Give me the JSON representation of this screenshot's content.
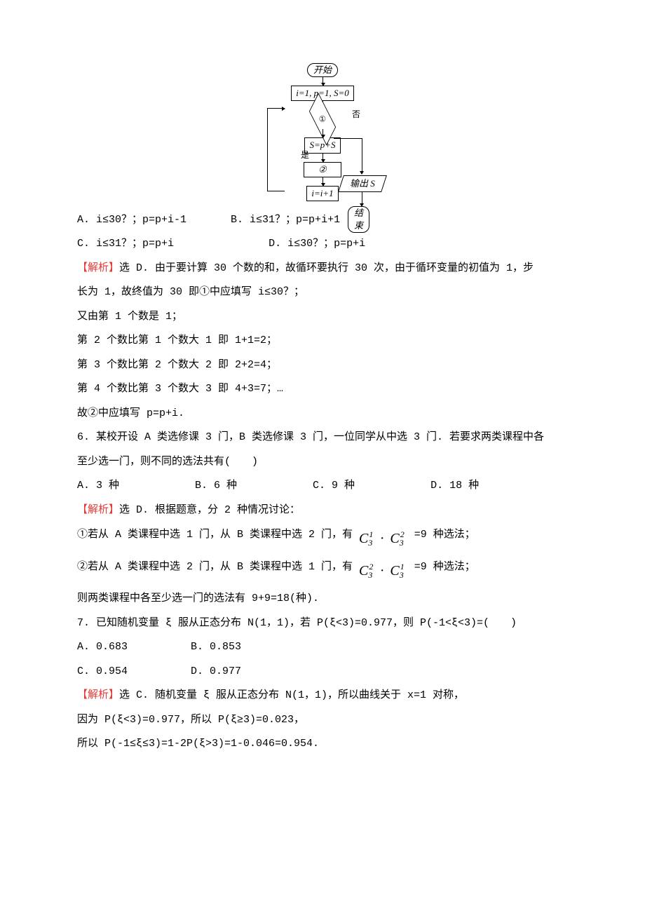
{
  "flow": {
    "start": "开始",
    "init": "i=1, p=1, S=0",
    "cond": "①",
    "yes": "是",
    "no": "否",
    "step1": "S=p+S",
    "out": "输出 S",
    "step2": "②",
    "end": "结束",
    "incr": "i=i+1"
  },
  "optA": "A. i≤30？；p=p+i-1",
  "optB": "B. i≤31？；p=p+i+1",
  "optC": "C. i≤31？；p=p+i",
  "optD": "D. i≤30？；p=p+i",
  "sol5_tag": "【解析】",
  "sol5_1a": "选 D. 由于要计算 30 个数的和，故循环要执行 30 次，由于循环变量的初值为 1，步",
  "sol5_1b": "长为 1，故终值为 30 即①中应填写 i≤30？；",
  "sol5_2": "又由第 1 个数是 1；",
  "sol5_3": "第 2 个数比第 1 个数大 1 即 1+1=2；",
  "sol5_4": "第 3 个数比第 2 个数大 2 即 2+2=4；",
  "sol5_5": "第 4 个数比第 3 个数大 3 即 4+3=7；…",
  "sol5_6": "故②中应填写 p=p+i.",
  "q6_1": "6. 某校开设 A 类选修课 3 门，B 类选修课 3 门，一位同学从中选 3 门. 若要求两类课程中各",
  "q6_2": "至少选一门，则不同的选法共有(　　)",
  "q6_opts": "A. 3 种            B. 6 种            C. 9 种            D. 18 种",
  "sol6_tag": "【解析】",
  "sol6_0": "选 D. 根据题意，分 2 种情况讨论：",
  "sol6_1a": "①若从 A 类课程中选 1 门，从 B 类课程中选 2 门，有",
  "sol6_1b": "=9 种选法；",
  "sol6_2a": "②若从 A 类课程中选 2 门，从 B 类课程中选 1 门，有",
  "sol6_2b": "=9 种选法；",
  "sol6_3": "则两类课程中各至少选一门的选法有 9+9=18(种).",
  "q7_1": "7. 已知随机变量 ξ 服从正态分布 N(1，1)，若 P(ξ<3)=0.977，则 P(-1<ξ<3)=(　　)",
  "q7_optsA": "A. 0.683          B. 0.853",
  "q7_optsB": "C. 0.954          D. 0.977",
  "sol7_tag": "【解析】",
  "sol7_0": "选 C. 随机变量 ξ 服从正态分布 N(1，1)，所以曲线关于 x=1 对称，",
  "sol7_1": "因为 P(ξ<3)=0.977，所以 P(ξ≥3)=0.023，",
  "sol7_2": "所以 P(-1≤ξ≤3)=1-2P(ξ>3)=1-0.046=0.954.",
  "comb": {
    "C": "C",
    "n": "3",
    "k1": "1",
    "k2": "2",
    "dot": "·"
  }
}
